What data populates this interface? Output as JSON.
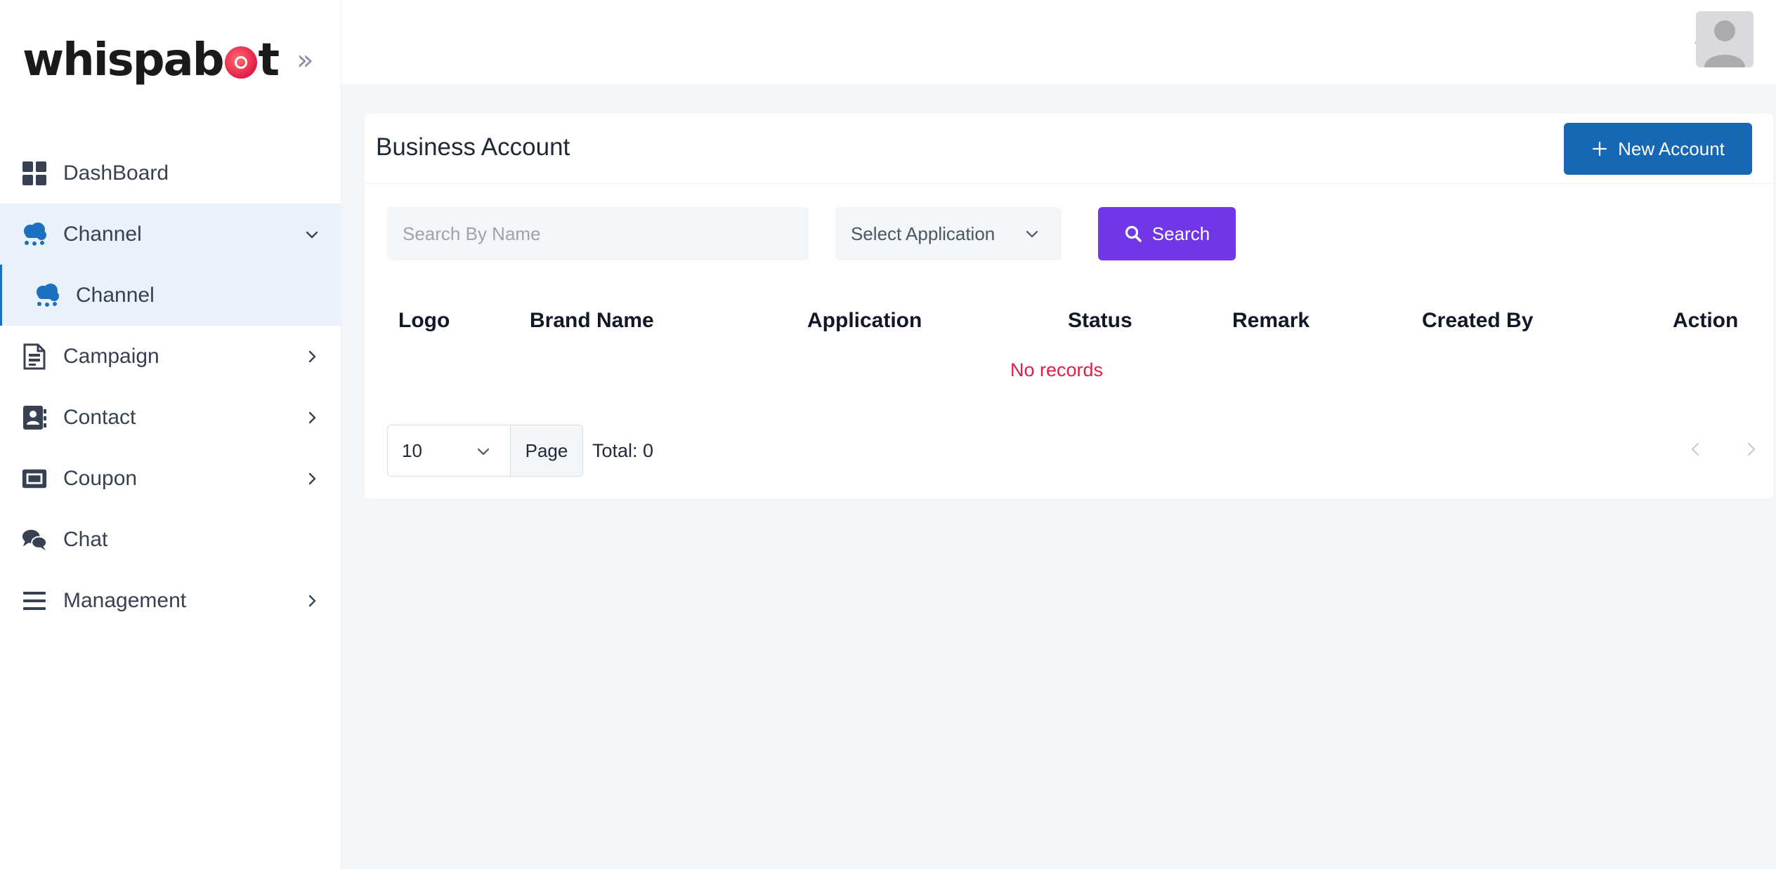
{
  "brand": {
    "name_pre": "whispab",
    "name_post": "t"
  },
  "sidebar": {
    "items": [
      {
        "label": "DashBoard"
      },
      {
        "label": "Channel"
      },
      {
        "label": "Channel"
      },
      {
        "label": "Campaign"
      },
      {
        "label": "Contact"
      },
      {
        "label": "Coupon"
      },
      {
        "label": "Chat"
      },
      {
        "label": "Management"
      }
    ]
  },
  "page": {
    "title": "Business Account",
    "new_button_label": "New Account"
  },
  "filters": {
    "search_placeholder": "Search By Name",
    "application_select": "Select Application",
    "search_button_label": "Search"
  },
  "table": {
    "columns": [
      "Logo",
      "Brand Name",
      "Application",
      "Status",
      "Remark",
      "Created By",
      "Action"
    ],
    "empty_text": "No records"
  },
  "pagination": {
    "page_size": "10",
    "page_label": "Page",
    "total_text": "Total: 0"
  },
  "colors": {
    "primary": "#1668b5",
    "accent": "#7137e6",
    "empty": "#e11d48",
    "active_bg": "#e9f1fb"
  }
}
